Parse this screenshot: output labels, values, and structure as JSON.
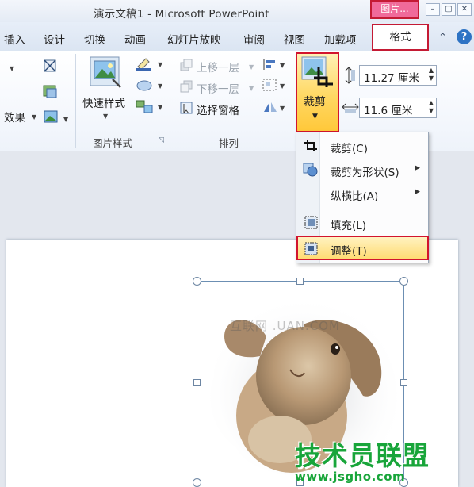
{
  "window": {
    "title": "演示文稿1 - Microsoft PowerPoint",
    "contextual_tab": "图片...",
    "buttons": [
      "–",
      "▢",
      "✕"
    ]
  },
  "tabs": [
    {
      "label": "插入"
    },
    {
      "label": "设计"
    },
    {
      "label": "切换"
    },
    {
      "label": "动画"
    },
    {
      "label": "幻灯片放映"
    },
    {
      "label": "审阅"
    },
    {
      "label": "视图"
    },
    {
      "label": "加载项"
    }
  ],
  "active_tab": "格式",
  "ribbon": {
    "effects_label": "效果",
    "quick_styles_label": "快速样式",
    "picture_styles_group": "图片样式",
    "arrange_group": "排列",
    "bring_forward": "上移一层",
    "send_backward": "下移一层",
    "selection_pane": "选择窗格",
    "crop_label": "裁剪",
    "height_value": "11.27 厘米",
    "width_value": "11.6 厘米"
  },
  "crop_menu": {
    "items": [
      {
        "label": "裁剪(C)",
        "icon": "crop-icon",
        "submenu": false
      },
      {
        "label": "裁剪为形状(S)",
        "icon": "shape-icon",
        "submenu": true
      },
      {
        "label": "纵横比(A)",
        "icon": "",
        "submenu": true
      },
      {
        "label": "填充(L)",
        "icon": "fill-icon",
        "submenu": false
      },
      {
        "label": "调整(T)",
        "icon": "fit-icon",
        "submenu": false,
        "highlighted": true
      }
    ]
  },
  "watermarks": {
    "site_faint": "互联网 .UAN.COM",
    "brand": "技术员联盟",
    "url": "www.jsgho.com"
  },
  "colors": {
    "highlight_border": "#d2142e",
    "crop_button": "#ffd863",
    "brand_green": "#18a53a"
  }
}
